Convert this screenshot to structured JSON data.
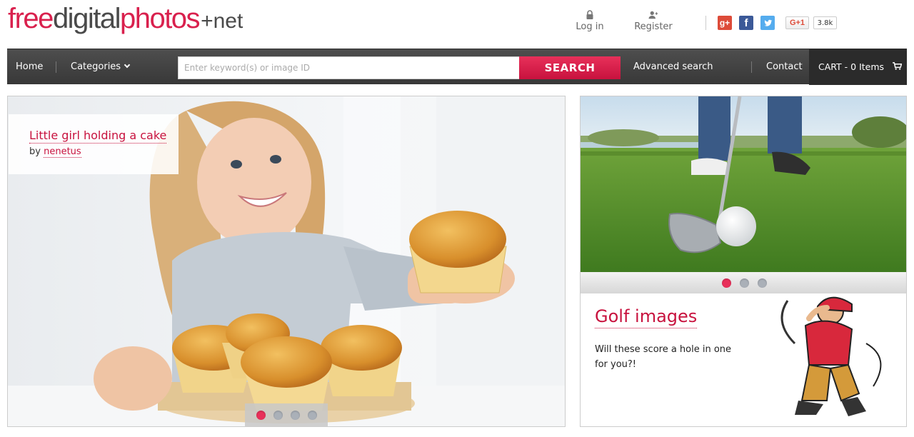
{
  "logo": {
    "part1": "free",
    "part2": "digital",
    "part3": "photos",
    "part4": "+net"
  },
  "header": {
    "login_label": "Log in",
    "register_label": "Register",
    "gplus_button_label": "G+1",
    "gplus_count": "3.8k",
    "social_icons": [
      "google-plus-icon",
      "facebook-icon",
      "twitter-icon"
    ]
  },
  "nav": {
    "home": "Home",
    "categories": "Categories",
    "search_placeholder": "Enter keyword(s) or image ID",
    "search_value": "",
    "search_button": "SEARCH",
    "advanced_search": "Advanced search",
    "contact": "Contact",
    "cart": "CART - 0 Items"
  },
  "hero": {
    "title": "Little girl holding a cake",
    "by_label": "by",
    "author": "nenetus",
    "slide_count": 4,
    "active_slide": 1
  },
  "side_panel": {
    "promo_title": "Golf images",
    "promo_text": "Will these score a hole in one for you?!",
    "slide_count": 3,
    "active_slide": 1
  },
  "colors": {
    "brand_red": "#c8123e",
    "nav_bg": "#444444",
    "cart_bg": "#2b2b2b"
  }
}
